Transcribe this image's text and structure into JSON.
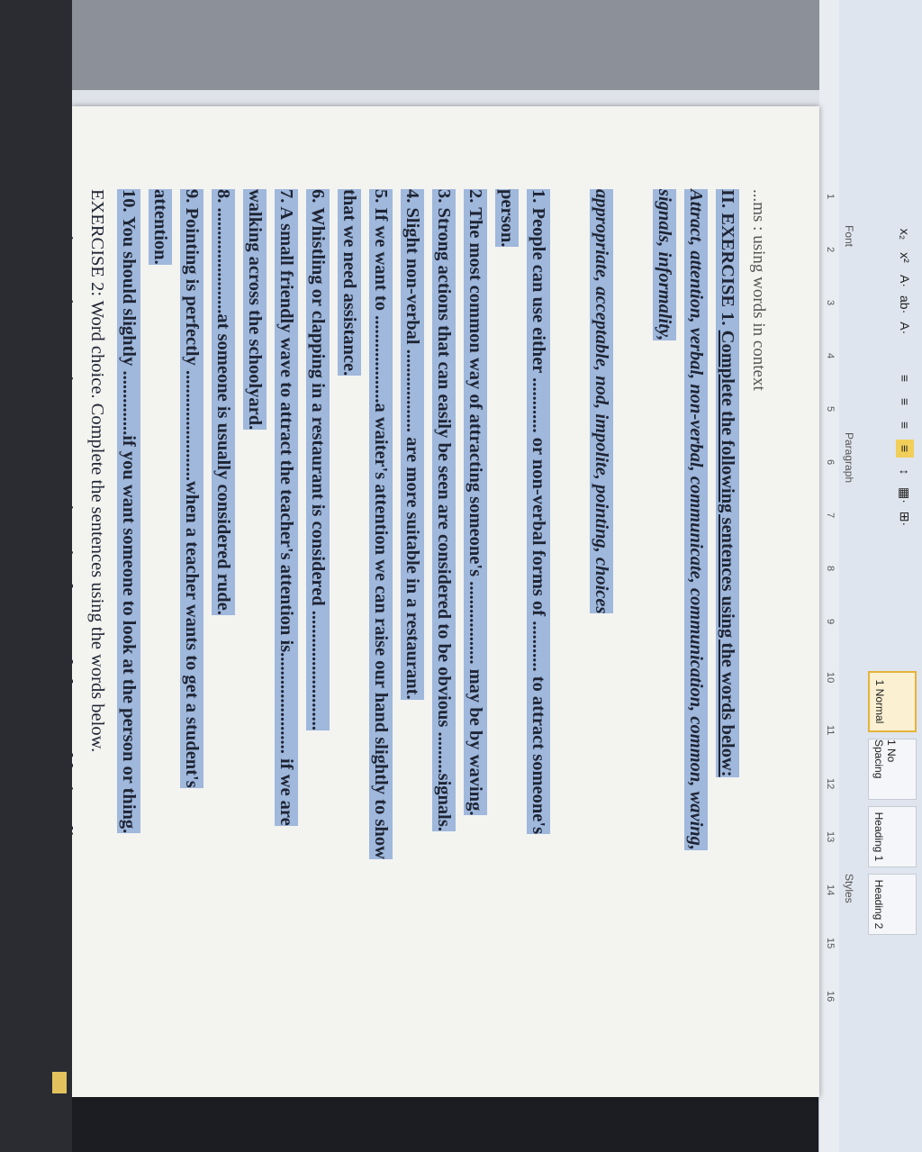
{
  "ribbon": {
    "group_labels": [
      "Font",
      "Paragraph",
      "Styles"
    ],
    "styles": [
      {
        "label": "1 Normal",
        "active": true
      },
      {
        "label": "1 No Spacing",
        "active": false
      },
      {
        "label": "Heading 1",
        "active": false
      },
      {
        "label": "Heading 2",
        "active": false
      }
    ],
    "tools_row1": [
      "x₂",
      "x²",
      "A·",
      "ab·",
      "A·"
    ],
    "tools_row2": [
      "≡",
      "≡",
      "≡",
      "≡",
      "↕",
      "▦·",
      "⊞·"
    ]
  },
  "ruler": {
    "ticks": [
      "1",
      "2",
      "3",
      "4",
      "5",
      "6",
      "7",
      "8",
      "9",
      "10",
      "11",
      "12",
      "13",
      "14",
      "15",
      "16"
    ]
  },
  "document": {
    "partial_heading": "...ms : using words in context",
    "heading": {
      "prefix": "II. EXERCISE 1. ",
      "underlined": "Complete the following sentences using the words below:"
    },
    "word_bank": [
      "Attract, attention, verbal, non-verbal, communicate, communication, common, waving,",
      "signals, informality,",
      "appropriate, acceptable, nod, impolite, pointing, choices"
    ],
    "sentences": [
      "1. People can use either ............ or non-verbal forms of ........... to attract someone's",
      "person.",
      "2. The most common way of attracting someone's .................. may be by waving.",
      "3. Strong actions that can easily be seen are considered to be obvious .........signals.",
      "4. Slight non-verbal .................. are more suitable in a restaurant.",
      "5. If we want to ...................a waiter's attention we can raise our hand slightly to show",
      "that we need assistance.",
      "6. Whistling or clapping in a restaurant is considered ..........................",
      "7. A small friendly wave to attract the teacher's attention is...................... if we are",
      "walking across the schoolyard.",
      "8. .......................at someone is usually considered rude.",
      "9. Pointing is perfectly ........................when a teacher wants to get a student's",
      "attention.",
      "10. You should slightly ..............if you want someone to look at the person or thing."
    ],
    "exercise2": {
      "title": "EXERCISE 2: Word choice. Complete the sentences using the words below.",
      "words": "attention:, assistant, assistance, appropriate, signal, non-verbal, acceptable, impolite,"
    }
  },
  "colors": {
    "highlight": "#9fb8dc",
    "page": "#f3f3f0",
    "ribbon": "#dfe5ee"
  }
}
